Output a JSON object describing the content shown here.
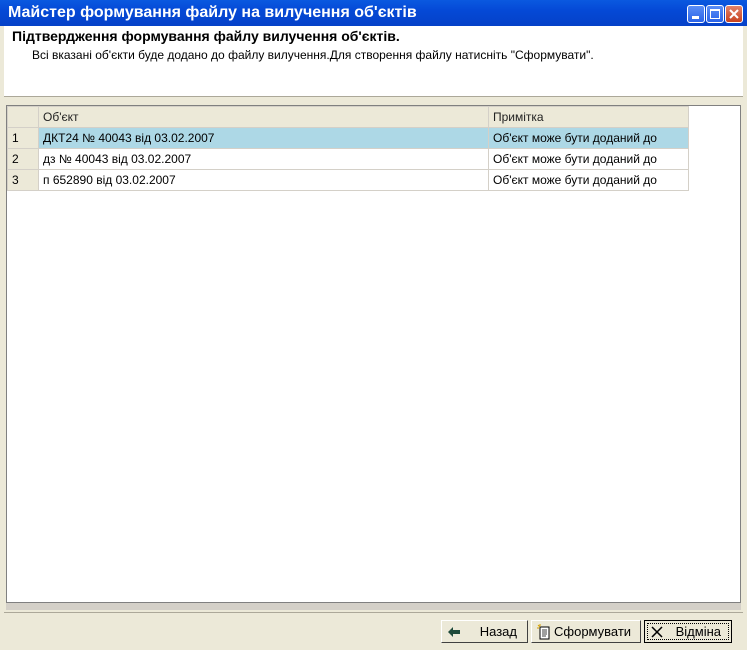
{
  "window": {
    "title": "Майстер формування файлу на вилучення об'єктів"
  },
  "header": {
    "title": "Підтвердження формування файлу вилучення об'єктів.",
    "description": "Всі вказані об'єкти буде додано до файлу вилучення.Для створення файлу натисніть  \"Сформувати\"."
  },
  "grid": {
    "columns": [
      "",
      "Об'єкт",
      "Примітка"
    ],
    "rows": [
      {
        "num": "1",
        "object": "ДКТ24 № 40043 від 03.02.2007",
        "note": "Об'єкт може бути доданий до"
      },
      {
        "num": "2",
        "object": "дз № 40043 від 03.02.2007",
        "note": "Об'єкт може бути доданий до"
      },
      {
        "num": "3",
        "object": "п 652890 від 03.02.2007",
        "note": "Об'єкт може бути доданий до"
      }
    ],
    "selected_row": 1
  },
  "buttons": {
    "back": {
      "label": "Назад",
      "icon": "arrow-left-icon"
    },
    "generate": {
      "label": "Сформувати",
      "icon": "document-new-icon"
    },
    "cancel": {
      "label": "Відміна",
      "icon": "close-x-icon"
    }
  },
  "colors": {
    "titlebar": "#0549d6",
    "selection": "#add8e6"
  }
}
